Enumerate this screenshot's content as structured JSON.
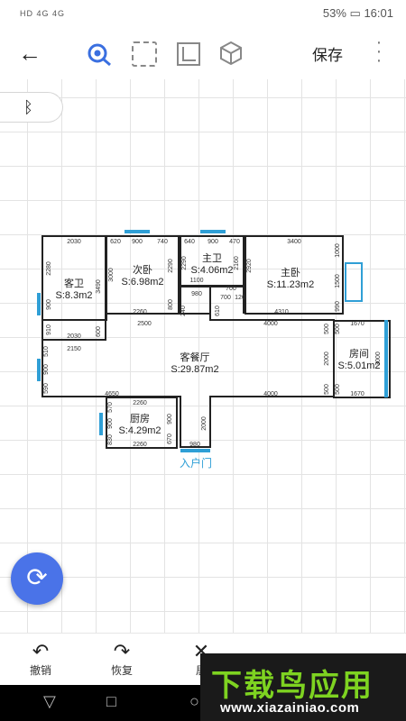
{
  "status": {
    "signal": "HD 4G 4G",
    "battery": "53%",
    "time": "16:01"
  },
  "toolbar": {
    "save_label": "保存",
    "more": "⋮",
    "back": "←"
  },
  "bluetooth_icon": "ᛒ",
  "rooms": {
    "kewei": {
      "name": "客卫",
      "area": "S:8.3m2"
    },
    "ciwo": {
      "name": "次卧",
      "area": "S:6.98m2"
    },
    "zhuwei": {
      "name": "主卫",
      "area": "S:4.06m2"
    },
    "zhuwo": {
      "name": "主卧",
      "area": "S:11.23m2"
    },
    "kecanting": {
      "name": "客餐厅",
      "area": "S:29.87m2"
    },
    "fangjian": {
      "name": "房间",
      "area": "S:5.01m2"
    },
    "chufang": {
      "name": "厨房",
      "area": "S:4.29m2"
    }
  },
  "entrance_label": "入户门",
  "dims": {
    "d2030a": "2030",
    "d620": "620",
    "d900a": "900",
    "d740": "740",
    "d640": "640",
    "d900b": "900",
    "d470": "470",
    "d3400": "3400",
    "d2280": "2280",
    "d900c": "900",
    "d910": "910",
    "d3490": "3490",
    "d600": "600",
    "d3000": "3000",
    "d2290": "2290",
    "d800": "800",
    "d2260a": "2260",
    "d2290b": "2290",
    "d2160": "2160",
    "d1100": "1100",
    "d980a": "980",
    "d700a": "700",
    "d700b": "700",
    "d120": "120",
    "d2920": "2920",
    "d1000": "1000",
    "d1500": "1500",
    "d990": "990",
    "d4310": "4310",
    "d2030b": "2030",
    "d2150": "2150",
    "d2500": "2500",
    "d4000a": "4000",
    "d1670a": "1670",
    "d510": "510",
    "d900d": "900",
    "d590": "590",
    "d500a": "500",
    "d2000a": "2000",
    "d500b": "500",
    "d3000b": "3000",
    "d4650": "4650",
    "d4000b": "4000",
    "d1670b": "1670",
    "d2260b": "2260",
    "d570": "570",
    "d900e": "900",
    "d830": "830",
    "d900f": "900",
    "d670": "670",
    "d2000b": "2000",
    "d2260c": "2260",
    "d980b": "980",
    "d240": "240",
    "d610": "610",
    "d500c": "500",
    "d500d": "500"
  },
  "bottom": {
    "undo": "撤销",
    "redo": "恢复",
    "third": "居"
  },
  "watermark": {
    "title": "下载鸟应用",
    "url": "www.xiazainiao.com"
  },
  "colors": {
    "accent": "#4a73e8",
    "wall": "#222222",
    "window": "#2f9fd6"
  }
}
